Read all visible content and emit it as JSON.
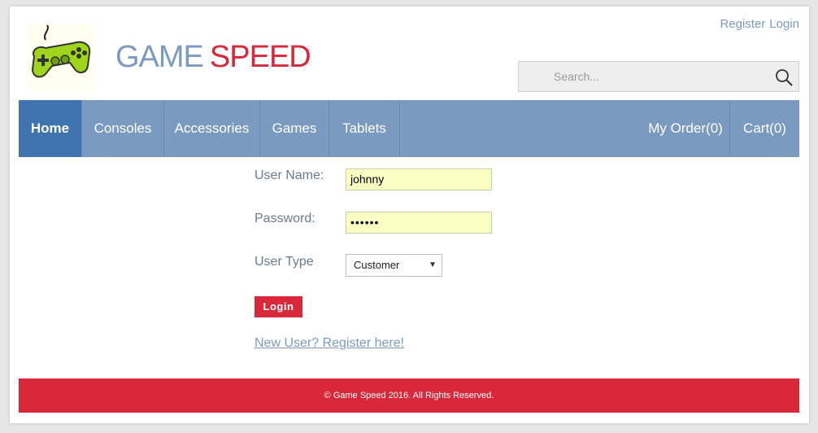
{
  "header": {
    "logo_word1": "GAME",
    "logo_word2": "SPEED",
    "register_link": "Register",
    "login_link": "Login",
    "search_placeholder": "Search..."
  },
  "nav": {
    "items": [
      {
        "label": "Home"
      },
      {
        "label": "Consoles"
      },
      {
        "label": "Accessories"
      },
      {
        "label": "Games"
      },
      {
        "label": "Tablets"
      }
    ],
    "my_order": "My Order(0)",
    "cart": "Cart(0)"
  },
  "form": {
    "username_label": "User Name:",
    "username_value": "johnny",
    "password_label": "Password:",
    "password_value": "••••••",
    "usertype_label": "User Type",
    "usertype_selected": "Customer",
    "login_button": "Login",
    "register_link": "New User? Register here!"
  },
  "footer": {
    "copyright": "© Game Speed 2016. All Rights Reserved."
  },
  "colors": {
    "brand_blue": "#7b9ac2",
    "nav_active": "#3f74b0",
    "brand_red": "#d9283a",
    "input_bg": "#fbffc3"
  }
}
